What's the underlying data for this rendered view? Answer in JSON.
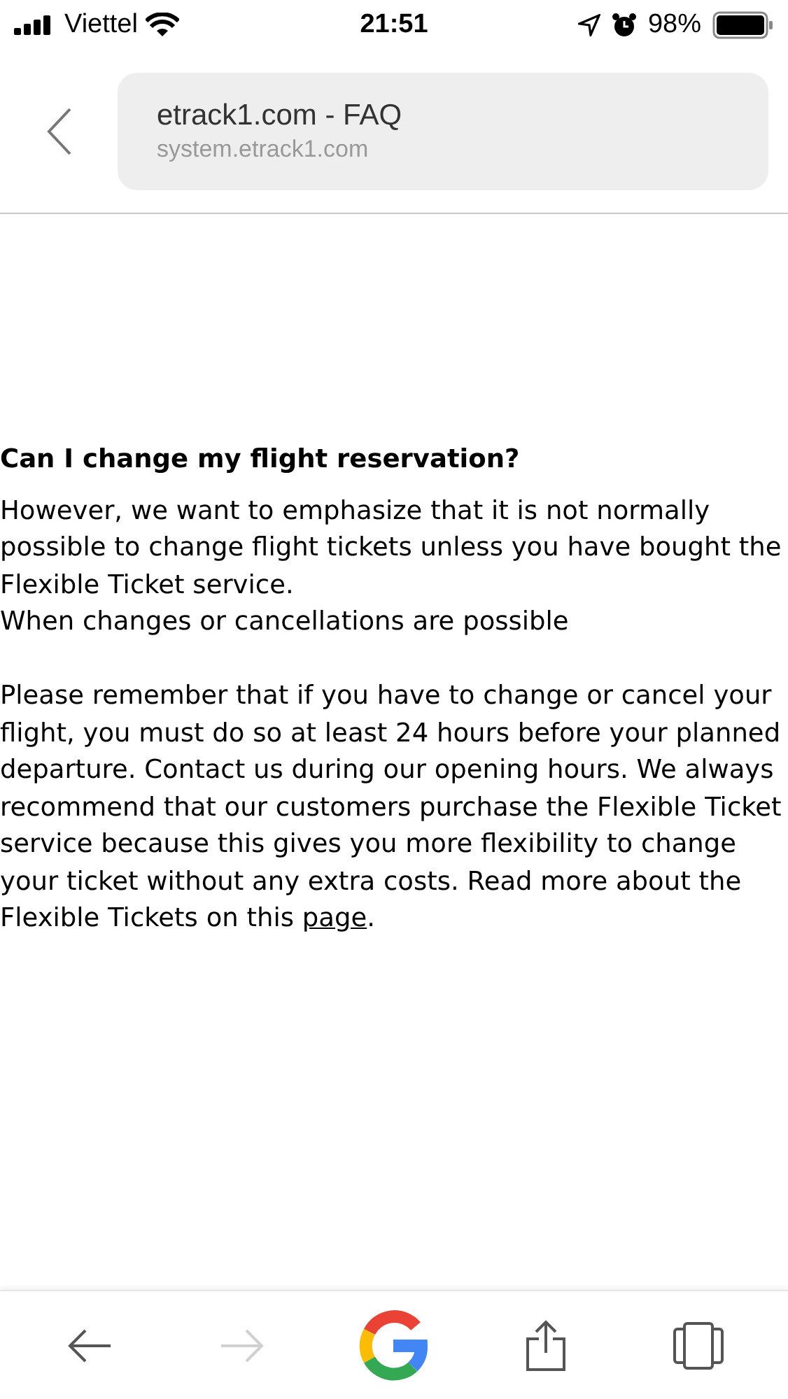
{
  "status_bar": {
    "carrier": "Viettel",
    "time": "21:51",
    "battery": "98%"
  },
  "header": {
    "title": "etrack1.com - FAQ",
    "url": "system.etrack1.com"
  },
  "article": {
    "heading": "Can I change my flight reservation?",
    "paragraph_1": "However, we want to emphasize that it is not normally possible to change flight tickets unless you have bought the Flexible Ticket service.",
    "subheading": "When changes or cancellations are possible",
    "paragraph_2": "Please remember that if you have to change or cancel your flight, you must do so at least 24 hours before your planned departure. Contact us during our opening hours. We always recommend that our customers purchase the Flexible Ticket service because this gives you more flexibility to change your ticket without any extra costs. Read more about the Flexible Tickets on this ",
    "link": "page",
    "paragraph_end": "."
  },
  "toolbar": {
    "back_disabled": false,
    "forward_disabled": true
  }
}
